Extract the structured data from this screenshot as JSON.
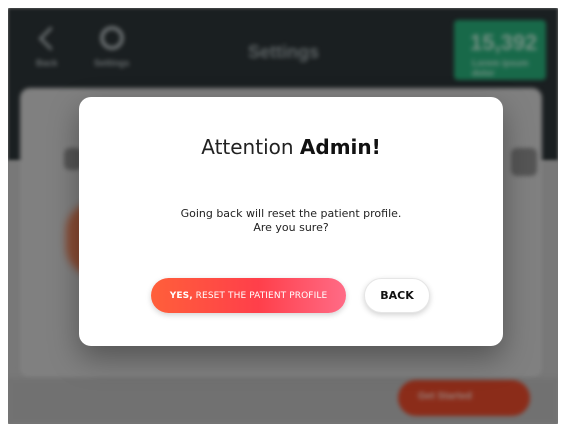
{
  "background_app": {
    "header": {
      "back_label": "Back",
      "settings_label": "Settings",
      "title": "Settings",
      "score_value": "15,392",
      "score_sub": "Lorem ipsum dolor"
    },
    "footer": {
      "action_button_label": "Get Started"
    }
  },
  "modal": {
    "title_prefix": "Attention ",
    "title_emphasis": "Admin!",
    "message_line1": "Going back will reset the patient profile.",
    "message_line2": "Are you sure?",
    "confirm_prefix": "YES,",
    "confirm_rest": " RESET THE PATIENT PROFILE",
    "back_label": "BACK"
  },
  "colors": {
    "primary_gradient_start": "#ff5f3a",
    "primary_gradient_mid": "#ff3f4a",
    "primary_gradient_end": "#ff6b86",
    "header_bg": "#2c3437",
    "score_badge": "#28b07b"
  },
  "icons": {
    "back": "chevron-left-icon",
    "settings": "gear-icon"
  }
}
